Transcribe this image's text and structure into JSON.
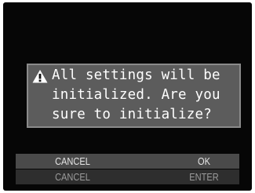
{
  "dialog": {
    "icon": "warning-icon",
    "message": "All settings will be\ninitialized. Are you\nsure to initialize?"
  },
  "softkeys": {
    "top_left": "CANCEL",
    "top_right": "OK",
    "bottom_left": "CANCEL",
    "bottom_right": "ENTER"
  },
  "colors": {
    "screen_background": "#060606",
    "dialog_background": "#5c5c5c",
    "dialog_border": "#8a8a8a",
    "softkey_top_background": "#4a4a4a",
    "softkey_bottom_background": "#2e2e2e"
  }
}
